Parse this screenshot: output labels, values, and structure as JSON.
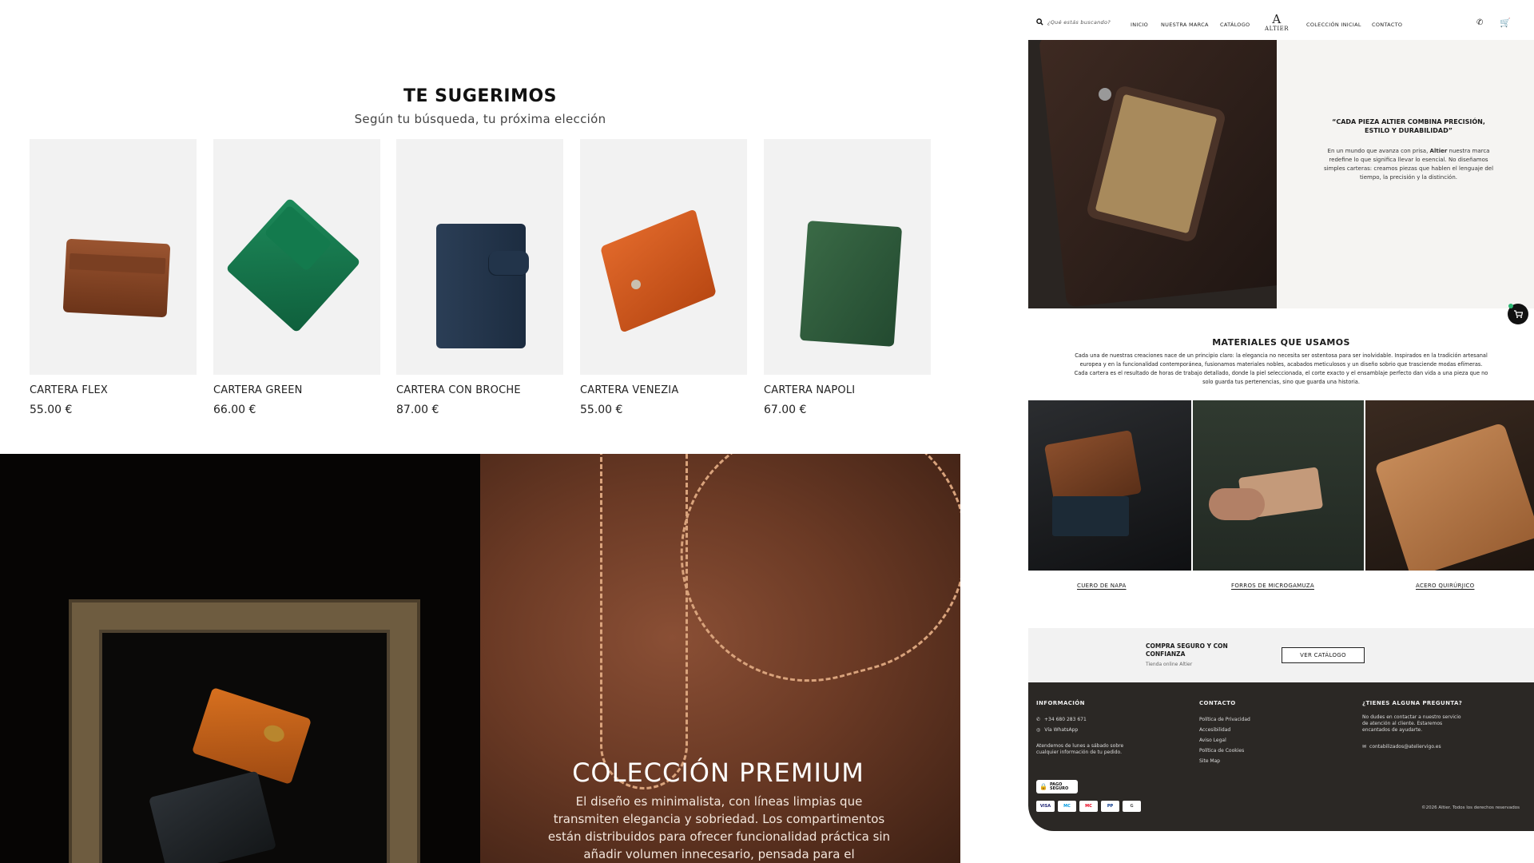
{
  "suggest": {
    "title": "TE SUGERIMOS",
    "subtitle": "Según tu búsqueda, tu próxima elección",
    "products": [
      {
        "name": "CARTERA FLEX",
        "price": "55.00 €",
        "color": "#8a4a2a"
      },
      {
        "name": "CARTERA GREEN",
        "price": "66.00 €",
        "color": "#16704a"
      },
      {
        "name": "CARTERA CON BROCHE",
        "price": "87.00 €",
        "color": "#22344a"
      },
      {
        "name": "CARTERA VENEZIA",
        "price": "55.00 €",
        "color": "#d0581c"
      },
      {
        "name": "CARTERA NAPOLI",
        "price": "67.00 €",
        "color": "#2d5a3a"
      }
    ]
  },
  "premium": {
    "title": "COLECCIÓN PREMIUM",
    "text": "El diseño es minimalista, con líneas limpias que transmiten elegancia y sobriedad. Los compartimentos están distribuidos para ofrecer funcionalidad práctica sin añadir volumen innecesario, pensada para el"
  },
  "nav": {
    "search_placeholder": "¿Qué estás buscando?",
    "links": [
      "INICIO",
      "NUESTRA MARCA",
      "CATÁLOGO",
      "COLECCIÓN INICIAL",
      "CONTACTO"
    ],
    "logo_mark": "A",
    "logo_text": "ALTIER"
  },
  "hero": {
    "quote": "“CADA PIEZA ALTIER COMBINA PRECISIÓN, ESTILO Y DURABILIDAD”",
    "para_before": "En un mundo que avanza con prisa, ",
    "para_brand": "Altier",
    "para_after": " nuestra marca redefine lo que significa llevar lo esencial. No diseñamos simples carteras: creamos piezas que hablen el lenguaje del tiempo, la precisión y la distinción."
  },
  "materials": {
    "title": "MATERIALES QUE USAMOS",
    "text": "Cada una de nuestras creaciones nace de un principio claro: la elegancia no necesita ser ostentosa para ser inolvidable. Inspirados en la tradición artesanal europea y en la funcionalidad contemporánea, fusionamos materiales nobles, acabados meticulosos y un diseño sobrio que trasciende modas efímeras. Cada cartera es el resultado de horas de trabajo detallado, donde la piel seleccionada, el corte exacto y el ensamblaje perfecto dan vida a una pieza que no solo guarda tus pertenencias, sino que guarda una historia.",
    "items": [
      "CUERO DE NAPA",
      "FORROS DE MICROGAMUZA",
      "ACERO QUIRÚRJICO"
    ]
  },
  "buy": {
    "title": "COMPRA SEGURO Y CON CONFIANZA",
    "subtitle": "Tienda online Altier",
    "button": "VER CATÁLOGO"
  },
  "footer": {
    "info_title": "INFORMACIÓN",
    "phone": "+34 680 283 671",
    "whatsapp": "Vía WhatsApp",
    "hours": "Atendemos de lunes a sábado sobre cualquier información de tu pedido.",
    "contact_title": "CONTACTO",
    "contact_links": [
      "Política de Privacidad",
      "Accesibilidad",
      "Aviso Legal",
      "Política de Cookies",
      "Site Map"
    ],
    "question_title": "¿TIENES ALGUNA PREGUNTA?",
    "question_text": "No dudes en contactar a nuestro servicio de atención al cliente. Estaremos encantados de ayudarte.",
    "email": "contabilizados@ateliervigo.es",
    "badge_line1": "PAGO",
    "badge_line2": "SEGURO",
    "cards": [
      "VISA",
      "MC",
      "MC",
      "PP",
      "G"
    ],
    "copyright": "©2026 Altier. Todos los derechos reservados"
  }
}
